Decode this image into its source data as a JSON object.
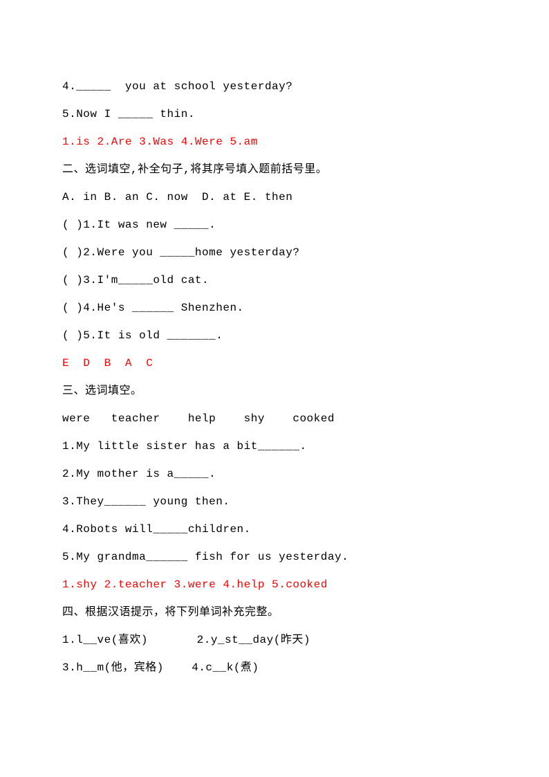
{
  "lines": [
    {
      "text": "4._____  you at school yesterday?",
      "cls": ""
    },
    {
      "text": "5.Now I _____ thin.",
      "cls": ""
    },
    {
      "text": "1.is 2.Are 3.Was 4.Were 5.am",
      "cls": "red"
    },
    {
      "text": "二、选词填空,补全句子,将其序号填入题前括号里。",
      "cls": ""
    },
    {
      "text": "A. in B. an C. now  D. at E. then",
      "cls": ""
    },
    {
      "text": "( )1.It was new _____.",
      "cls": ""
    },
    {
      "text": "( )2.Were you _____home yesterday?",
      "cls": ""
    },
    {
      "text": "( )3.I'm_____old cat.",
      "cls": ""
    },
    {
      "text": "( )4.He's ______ Shenzhen.",
      "cls": ""
    },
    {
      "text": "( )5.It is old _______.",
      "cls": ""
    },
    {
      "text": "E  D  B  A  C",
      "cls": "red"
    },
    {
      "text": "三、选词填空。",
      "cls": ""
    },
    {
      "text": "were   teacher    help    shy    cooked",
      "cls": ""
    },
    {
      "text": "1.My little sister has a bit______.",
      "cls": ""
    },
    {
      "text": "2.My mother is a_____.",
      "cls": ""
    },
    {
      "text": "3.They______ young then.",
      "cls": ""
    },
    {
      "text": "4.Robots will_____children.",
      "cls": ""
    },
    {
      "text": "5.My grandma______ fish for us yesterday.",
      "cls": ""
    },
    {
      "text": "1.shy 2.teacher 3.were 4.help 5.cooked",
      "cls": "red"
    },
    {
      "text": "四、根据汉语提示，将下列单词补充完整。",
      "cls": ""
    },
    {
      "text": "1.l__ve(喜欢)       2.y_st__day(昨天)",
      "cls": ""
    },
    {
      "text": "3.h__m(他，宾格)    4.c__k(煮)",
      "cls": ""
    }
  ]
}
